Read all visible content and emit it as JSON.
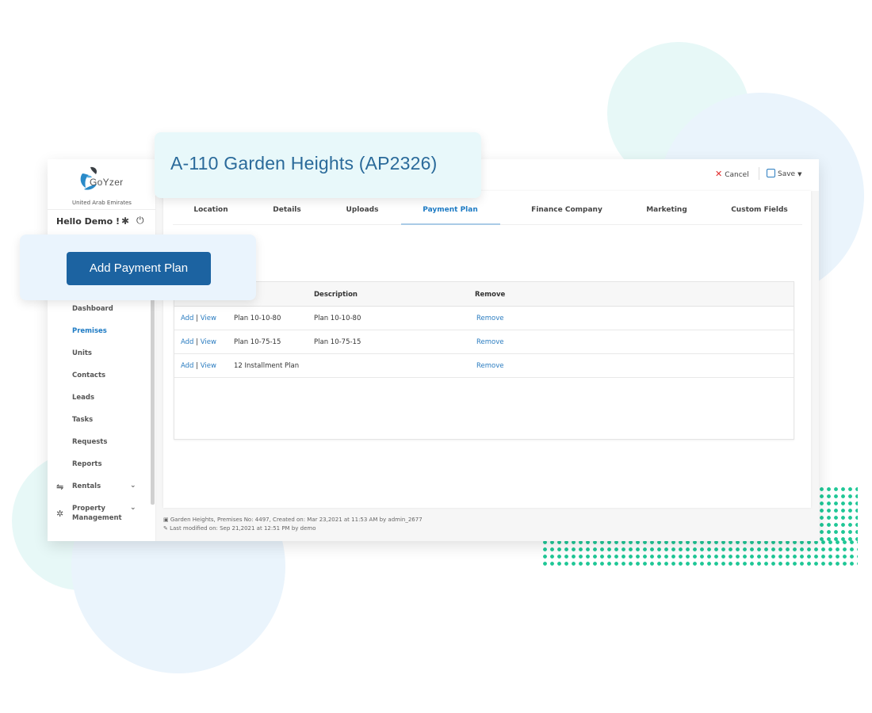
{
  "header": {
    "title": "A-110 Garden Heights (AP2326)",
    "cancel_label": "Cancel",
    "save_label": "Save"
  },
  "brand": {
    "name": "GoYzer",
    "region": "United Arab Emirates",
    "accent": "#1e7bc4",
    "button_color": "#1c63a1",
    "dots_color": "#1fc796"
  },
  "user": {
    "greeting": "Hello Demo !"
  },
  "sidebar": {
    "items": [
      {
        "label": "Dashboard",
        "active": false
      },
      {
        "label": "Premises",
        "active": true
      },
      {
        "label": "Units",
        "active": false
      },
      {
        "label": "Contacts",
        "active": false
      },
      {
        "label": "Leads",
        "active": false
      },
      {
        "label": "Tasks",
        "active": false
      },
      {
        "label": "Requests",
        "active": false
      },
      {
        "label": "Reports",
        "active": false
      }
    ],
    "groups": [
      {
        "label": "Rentals",
        "icon": "handshake-icon"
      },
      {
        "label": "Property Management",
        "icon": "gear-outline-icon"
      }
    ]
  },
  "tabs": [
    {
      "label": "Location",
      "active": false
    },
    {
      "label": "Details",
      "active": false
    },
    {
      "label": "Uploads",
      "active": false
    },
    {
      "label": "Payment Plan",
      "active": true
    },
    {
      "label": "Finance Company",
      "active": false
    },
    {
      "label": "Marketing",
      "active": false
    },
    {
      "label": "Custom Fields",
      "active": false
    }
  ],
  "actions": {
    "add_payment_plan": "Add Payment Plan"
  },
  "table": {
    "columns": [
      "",
      "",
      "Description",
      "Remove"
    ],
    "rows": [
      {
        "add": "Add",
        "view": "View",
        "name": "Plan 10-10-80",
        "description": "Plan 10-10-80",
        "remove": "Remove"
      },
      {
        "add": "Add",
        "view": "View",
        "name": "Plan 10-75-15",
        "description": "Plan 10-75-15",
        "remove": "Remove"
      },
      {
        "add": "Add",
        "view": "View",
        "name": "12 Installment Plan",
        "description": "",
        "remove": "Remove"
      }
    ]
  },
  "footer": {
    "created": "Garden Heights, Premises No: 4497, Created on: Mar 23,2021 at 11:53 AM by admin_2677",
    "modified": "Last modified on: Sep 21,2021 at 12:51 PM by demo"
  }
}
